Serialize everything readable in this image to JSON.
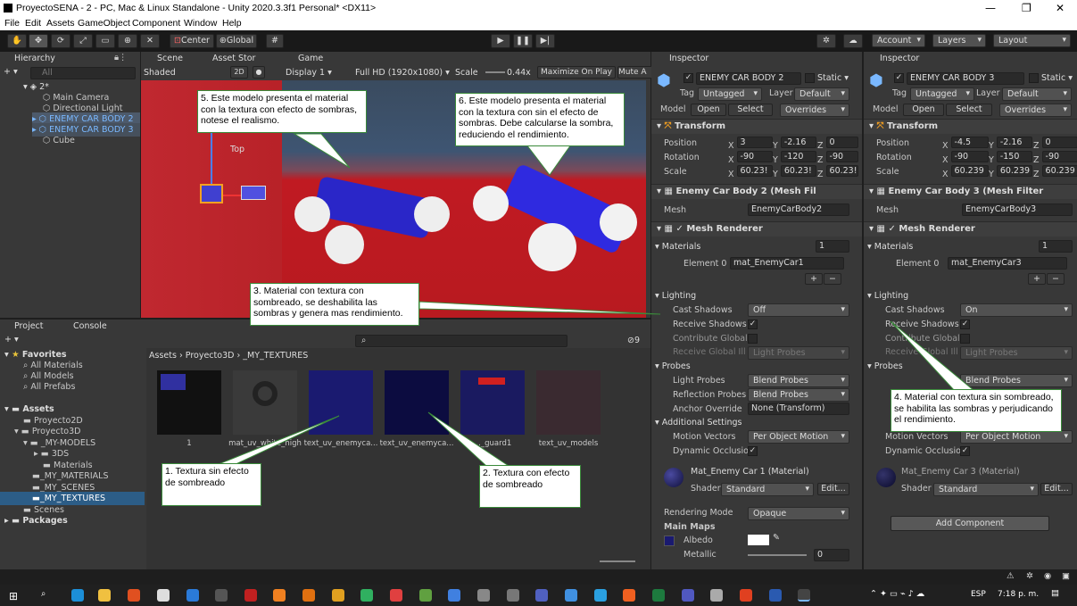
{
  "window": {
    "title": "ProyectoSENA - 2 - PC, Mac & Linux Standalone - Unity 2020.3.3f1 Personal* <DX11>",
    "min": "—",
    "max": "❐",
    "close": "✕"
  },
  "menu": [
    "File",
    "Edit",
    "Assets",
    "GameObject",
    "Component",
    "Window",
    "Help"
  ],
  "toolbar": {
    "center": "Center",
    "global": "Global",
    "account": "Account",
    "layers": "Layers",
    "layout": "Layout"
  },
  "hierarchy": {
    "tab": "Hierarchy",
    "search": "All",
    "scene": "2*",
    "items": [
      "Main Camera",
      "Directional Light",
      "ENEMY CAR BODY 2",
      "ENEMY CAR BODY 3",
      "Cube"
    ]
  },
  "scene": {
    "tab": "Scene",
    "tab2": "Asset Stor",
    "shaded": "Shaded",
    "mode": "2D",
    "top_label": "Top"
  },
  "game": {
    "tab": "Game",
    "display": "Display 1",
    "res": "Full HD (1920x1080)",
    "scale_label": "Scale",
    "scale": "0.44x",
    "maximize": "Maximize On Play",
    "mute": "Mute A"
  },
  "project": {
    "tab": "Project",
    "tab2": "Console",
    "count": "9",
    "breadcrumb": [
      "Assets",
      "Proyecto3D",
      "_MY_TEXTURES"
    ],
    "tree": [
      {
        "label": "Favorites",
        "bold": true
      },
      {
        "label": "All Materials"
      },
      {
        "label": "All Models"
      },
      {
        "label": "All Prefabs"
      },
      {
        "label": "Assets",
        "bold": true
      },
      {
        "label": "Proyecto2D"
      },
      {
        "label": "Proyecto3D"
      },
      {
        "label": "_MY-MODELS"
      },
      {
        "label": "3DS"
      },
      {
        "label": "Materials"
      },
      {
        "label": "_MY_MATERIALS"
      },
      {
        "label": "_MY_SCENES"
      },
      {
        "label": "_MY_TEXTURES"
      },
      {
        "label": "Scenes"
      },
      {
        "label": "Packages",
        "bold": true
      }
    ],
    "assets": [
      "1",
      "mat_uv_white_high",
      "text_uv_enemyca...",
      "text_uv_enemyca...",
      "..._guard1",
      "text_uv_models"
    ]
  },
  "insp1": {
    "tab": "Inspector",
    "name": "ENEMY CAR BODY 2",
    "static": "Static",
    "tag_label": "Tag",
    "tag": "Untagged",
    "layer_label": "Layer",
    "layer": "Default",
    "model": "Model",
    "open": "Open",
    "select": "Select",
    "overrides": "Overrides",
    "transform": "Transform",
    "position": "Position",
    "rotation": "Rotation",
    "scale": "Scale",
    "pos": [
      "3",
      "-2.16",
      "0"
    ],
    "rot": [
      "-90",
      "-120",
      "-90"
    ],
    "scl": [
      "60.23!",
      "60.23!",
      "60.23!"
    ],
    "meshfilter": "Enemy Car Body 2 (Mesh Fil",
    "mesh_label": "Mesh",
    "mesh": "EnemyCarBody2",
    "renderer": "Mesh Renderer",
    "materials": "Materials",
    "mat_count": "1",
    "element0": "Element 0",
    "mat": "mat_EnemyCar1",
    "lighting": "Lighting",
    "cast": "Cast Shadows",
    "cast_val": "Off",
    "receive": "Receive Shadows",
    "contrib": "Contribute Global",
    "recvgi": "Receive Global Illu",
    "lightprobes_val": "Light Probes",
    "probes": "Probes",
    "lp": "Light Probes",
    "lp_val": "Blend Probes",
    "rp": "Reflection Probes",
    "rp_val": "Blend Probes",
    "ao": "Anchor Override",
    "ao_val": "None (Transform)",
    "addl": "Additional Settings",
    "mv": "Motion Vectors",
    "mv_val": "Per Object Motion",
    "doc": "Dynamic Occlusio",
    "material": "Mat_Enemy Car 1 (Material)",
    "shader": "Shader",
    "shader_val": "Standard",
    "edit": "Edit...",
    "rmode": "Rendering Mode",
    "rmode_val": "Opaque",
    "mainmaps": "Main Maps",
    "albedo": "Albedo",
    "metallic": "Metallic",
    "metallic_val": "0"
  },
  "insp2": {
    "tab": "Inspector",
    "name": "ENEMY CAR BODY 3",
    "static": "Static",
    "tag": "Untagged",
    "layer": "Default",
    "pos": [
      "-4.5",
      "-2.16",
      "0"
    ],
    "rot": [
      "-90",
      "-150",
      "-90"
    ],
    "scl": [
      "60.239",
      "60.239",
      "60.239"
    ],
    "meshfilter": "Enemy Car Body 3 (Mesh Filter",
    "mesh": "EnemyCarBody3",
    "mat": "mat_EnemyCar3",
    "cast_val": "On",
    "mv_val": "Per Object Motion",
    "material": "Mat_Enemy Car 3 (Material)",
    "add": "Add Component"
  },
  "notes": {
    "n1": "1. Textura sin efecto de sombreado",
    "n2": "2. Textura con efecto de sombreado",
    "n3": "3. Material con textura con sombreado, se deshabilita las sombras y genera mas rendimiento.",
    "n4": "4. Material con textura sin sombreado, se habilita las sombras y perjudicando el rendimiento.",
    "n5": "5. Este modelo presenta el material con la textura con efecto de sombras, notese el realismo.",
    "n6": "6. Este modelo presenta el material con la textura con sin el efecto de sombras. Debe calcularse la sombra, reduciendo el rendimiento."
  },
  "taskbar": {
    "lang": "ESP",
    "time": "7:18 p. m."
  }
}
